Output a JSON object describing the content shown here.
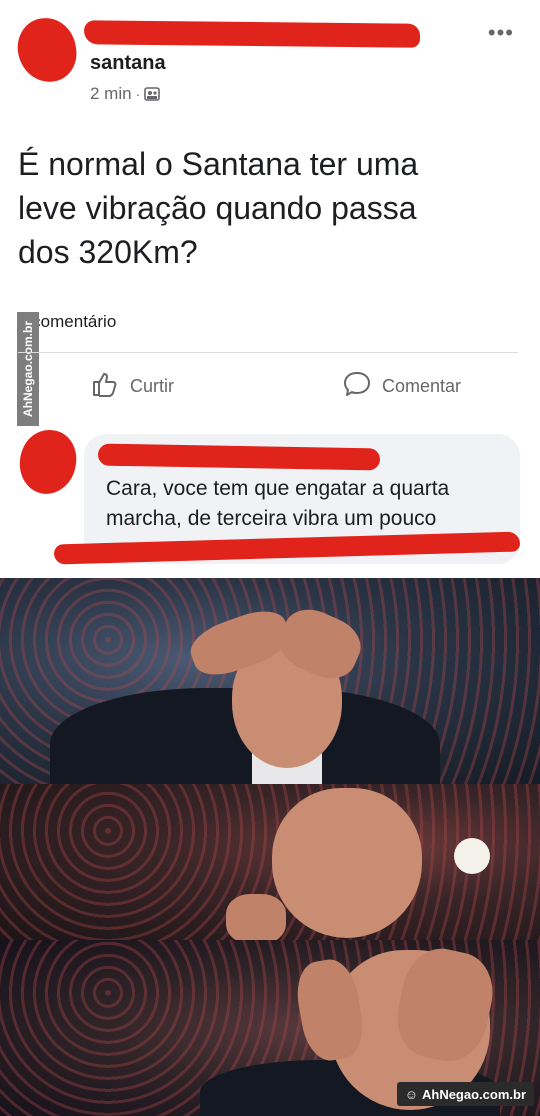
{
  "post": {
    "author": "santana",
    "time": "2 min",
    "separator": "·",
    "privacy_icon": "friends-privacy-icon",
    "more_label": "•••",
    "text": "É  normal o Santana ter uma\nleve vibração  quando passa\ndos 320Km?",
    "comment_count": "1 comentário"
  },
  "actions": {
    "like_label": "Curtir",
    "comment_label": "Comentar"
  },
  "comment": {
    "text": "Cara, voce tem que engatar a quarta marcha, de terceira vibra um pouco mesmo"
  },
  "watermarks": {
    "side": "AhNegao.com.br",
    "badge": "AhNegao.com.br"
  },
  "colors": {
    "scribble": "#e0241b",
    "text": "#1c1e21",
    "secondary": "#65676b",
    "bubble": "#f0f2f5"
  }
}
